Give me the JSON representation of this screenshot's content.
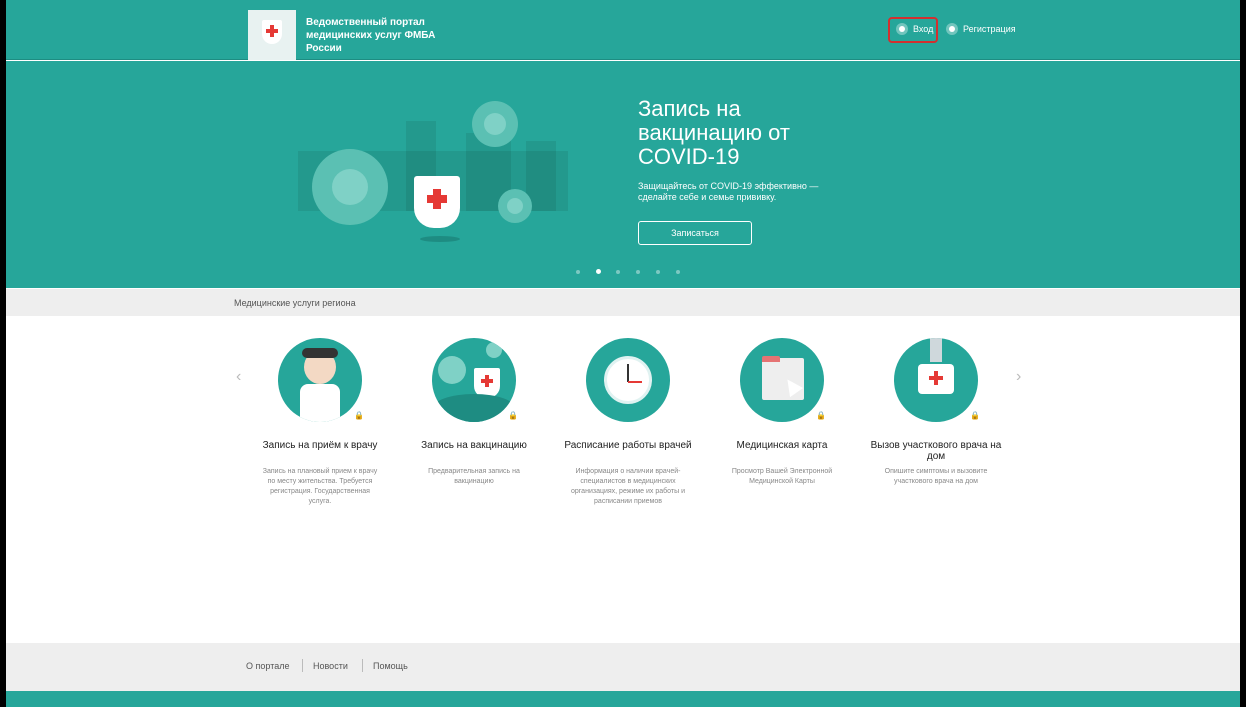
{
  "header": {
    "portal_title": "Ведомственный портал медицинских услуг ФМБА России",
    "login_label": "Вход",
    "register_label": "Регистрация"
  },
  "hero": {
    "title": "Запись на вакцинацию от COVID-19",
    "subtitle": "Защищайтесь от COVID-19 эффективно — сделайте себе и семье прививку.",
    "button_label": "Записаться",
    "active_slide": 2,
    "total_slides": 6
  },
  "section": {
    "title": "Медицинские услуги региона"
  },
  "services": [
    {
      "title": "Запись на приём к врачу",
      "description": "Запись на плановый прием к врачу по месту жительства. Требуется регистрация. Государственная услуга."
    },
    {
      "title": "Запись на вакцинацию",
      "description": "Предварительная запись на вакцинацию"
    },
    {
      "title": "Расписание работы врачей",
      "description": "Информация о наличии врачей-специалистов в медицинских организациях, режиме их работы и расписании приемов"
    },
    {
      "title": "Медицинская карта",
      "description": "Просмотр Вашей Электронной Медицинской Карты"
    },
    {
      "title": "Вызов участкового врача на дом",
      "description": "Опишите симптомы и вызовите участкового врача на дом"
    }
  ],
  "footer": {
    "links": [
      "О портале",
      "Новости",
      "Помощь"
    ]
  },
  "colors": {
    "brand": "#26a69a",
    "accent": "#e53935",
    "highlight": "#d32f2f"
  }
}
